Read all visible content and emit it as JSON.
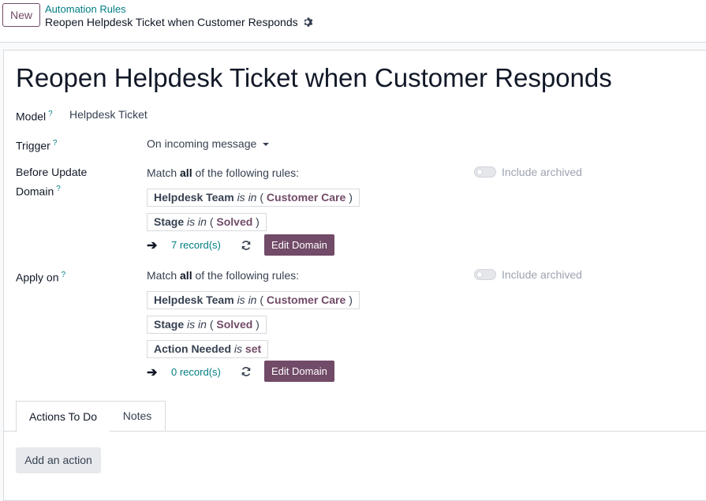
{
  "header": {
    "new_label": "New",
    "breadcrumb_parent": "Automation Rules",
    "breadcrumb_current": "Reopen Helpdesk Ticket when Customer Responds",
    "gear_icon": "gear-icon"
  },
  "record": {
    "title": "Reopen Helpdesk Ticket when Customer Responds",
    "help_mark": "?",
    "model": {
      "label": "Model",
      "value": "Helpdesk Ticket"
    },
    "trigger": {
      "label": "Trigger",
      "value": "On incoming message"
    },
    "before_update": {
      "label_line1": "Before Update",
      "label_line2": "Domain",
      "match_prefix": "Match",
      "match_all": "all",
      "match_suffix": "of the following rules:",
      "include_archived": "Include archived",
      "rules": [
        {
          "field": "Helpdesk Team",
          "op": "is in",
          "open": "(",
          "value": "Customer Care",
          "close": ")"
        },
        {
          "field": "Stage",
          "op": "is in",
          "open": "(",
          "value": "Solved",
          "close": ")"
        }
      ],
      "records": "7 record(s)",
      "edit_label": "Edit Domain"
    },
    "apply_on": {
      "label": "Apply on",
      "match_prefix": "Match",
      "match_all": "all",
      "match_suffix": "of the following rules:",
      "include_archived": "Include archived",
      "rules": [
        {
          "field": "Helpdesk Team",
          "op": "is in",
          "open": "(",
          "value": "Customer Care",
          "close": ")"
        },
        {
          "field": "Stage",
          "op": "is in",
          "open": "(",
          "value": "Solved",
          "close": ")"
        },
        {
          "field": "Action Needed",
          "op": "is",
          "value": "set"
        }
      ],
      "records": "0 record(s)",
      "edit_label": "Edit Domain"
    },
    "tabs": [
      {
        "label": "Actions To Do"
      },
      {
        "label": "Notes"
      }
    ],
    "add_action_label": "Add an action"
  },
  "colors": {
    "primary": "#714b67",
    "link": "#017e84"
  }
}
